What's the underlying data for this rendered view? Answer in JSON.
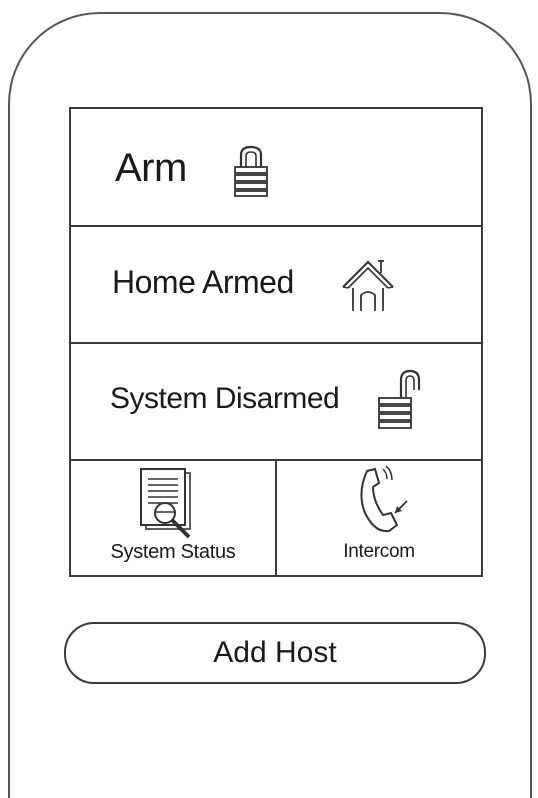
{
  "menu": {
    "arm": {
      "label": "Arm",
      "icon": "lock-closed-icon"
    },
    "home_armed": {
      "label": "Home Armed",
      "icon": "house-icon"
    },
    "system_disarmed": {
      "label": "System Disarmed",
      "icon": "lock-open-icon"
    },
    "system_status": {
      "label": "System Status",
      "icon": "document-search-icon"
    },
    "intercom": {
      "label": "Intercom",
      "icon": "phone-icon"
    }
  },
  "add_host": {
    "label": "Add Host"
  },
  "colors": {
    "line": "#3a3a3a",
    "background": "#ffffff",
    "text": "#1a1a1a"
  }
}
